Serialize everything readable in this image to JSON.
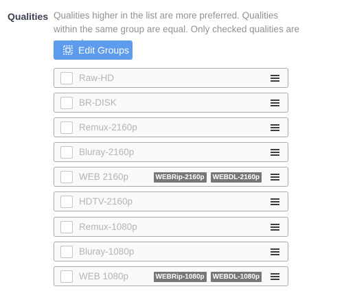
{
  "field": {
    "label": "Qualities",
    "help_text": "Qualities higher in the list are more preferred. Qualities within the same group are equal. Only checked qualities are wanted"
  },
  "edit_groups_button": {
    "label": "Edit Groups",
    "icon": "edit-groups-icon",
    "color": "#5d9cec"
  },
  "qualities": [
    {
      "name": "Raw-HD",
      "checked": false,
      "tags": []
    },
    {
      "name": "BR-DISK",
      "checked": false,
      "tags": []
    },
    {
      "name": "Remux-2160p",
      "checked": false,
      "tags": []
    },
    {
      "name": "Bluray-2160p",
      "checked": false,
      "tags": []
    },
    {
      "name": "WEB 2160p",
      "checked": false,
      "tags": [
        "WEBRip-2160p",
        "WEBDL-2160p"
      ]
    },
    {
      "name": "HDTV-2160p",
      "checked": false,
      "tags": []
    },
    {
      "name": "Remux-1080p",
      "checked": false,
      "tags": []
    },
    {
      "name": "Bluray-1080p",
      "checked": false,
      "tags": []
    },
    {
      "name": "WEB 1080p",
      "checked": false,
      "tags": [
        "WEBRip-1080p",
        "WEBDL-1080p"
      ]
    }
  ]
}
